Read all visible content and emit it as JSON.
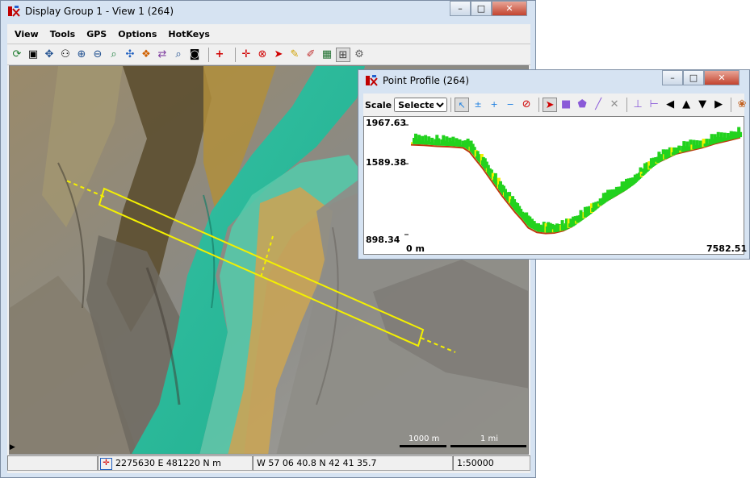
{
  "main_window": {
    "title": "Display Group 1 - View 1 (264)",
    "app_icon": "tntmips-icon",
    "controls": {
      "minimize": "–",
      "maximize": "□",
      "close": "✕"
    },
    "menu": [
      "View",
      "Tools",
      "GPS",
      "Options",
      "HotKeys"
    ],
    "toolbar_icons": [
      "redraw-icon",
      "full-extent-icon",
      "zoom-box-icon",
      "fit-icon",
      "zoom-in-icon",
      "zoom-out-icon",
      "zoom-to-selection-icon",
      "pan-icon",
      "layer-controls-icon",
      "swap-icon",
      "magnify-icon",
      "snapshot-icon",
      "add-layer-icon",
      "move-icon",
      "zoom-tool-icon",
      "select-arrow-icon",
      "measure-icon",
      "sketch-icon",
      "profile-icon",
      "grid-icon",
      "gps-icon"
    ],
    "scale_bars": {
      "metric": "1000 m",
      "imperial": "1 mi"
    },
    "status": {
      "projected": "2275630 E  481220 N m",
      "geographic": "W 57 06 40.8  N 42 41 35.7",
      "scale": "1:50000"
    }
  },
  "profile_window": {
    "title": "Point Profile (264)",
    "app_icon": "tntmips-icon",
    "controls": {
      "minimize": "–",
      "maximize": "□",
      "close": "✕"
    },
    "scale_label": "Scale",
    "scale_value": "Selected",
    "toolbar_icons": [
      "select-one-icon",
      "toggle-select-icon",
      "add-select-icon",
      "remove-select-icon",
      "clear-select-icon",
      "select-arrow-icon",
      "rectangle-icon",
      "polygon-icon",
      "line-icon",
      "cancel-icon",
      "horizontal-ruler-icon",
      "vertical-ruler-icon",
      "arrow-left-icon",
      "arrow-up-icon",
      "arrow-down-icon",
      "arrow-right-icon",
      "palette-icon"
    ],
    "colors": {
      "vegetation": "#22d21e",
      "ground": "#c03a10",
      "highlight": "#f4f000"
    }
  },
  "chart_data": {
    "type": "scatter",
    "title": "",
    "xlabel": "",
    "ylabel": "",
    "xlim": [
      0,
      7582.51
    ],
    "ylim": [
      898.34,
      1967.63
    ],
    "x_tick_labels": [
      "0 m",
      "7582.51"
    ],
    "y_tick_labels": [
      "1967.63",
      "1589.38",
      "898.34"
    ],
    "series": [
      {
        "x": [
          0,
          300,
          600,
          900,
          1200,
          1350,
          1500,
          1650,
          1800,
          1950,
          2100,
          2250,
          2400,
          2550,
          2700,
          2900,
          3100,
          3300,
          3500,
          3700,
          3900,
          4100,
          4300,
          4500,
          4700,
          4900,
          5100,
          5300,
          5500,
          5700,
          5900,
          6100,
          6400,
          6700,
          7000,
          7300,
          7582
        ],
        "y": [
          1790,
          1785,
          1775,
          1770,
          1760,
          1720,
          1640,
          1560,
          1470,
          1380,
          1290,
          1210,
          1130,
          1060,
          980,
          935,
          925,
          930,
          950,
          990,
          1050,
          1110,
          1180,
          1240,
          1290,
          1340,
          1400,
          1480,
          1560,
          1620,
          1660,
          1700,
          1730,
          1760,
          1800,
          1830,
          1860
        ]
      }
    ]
  }
}
